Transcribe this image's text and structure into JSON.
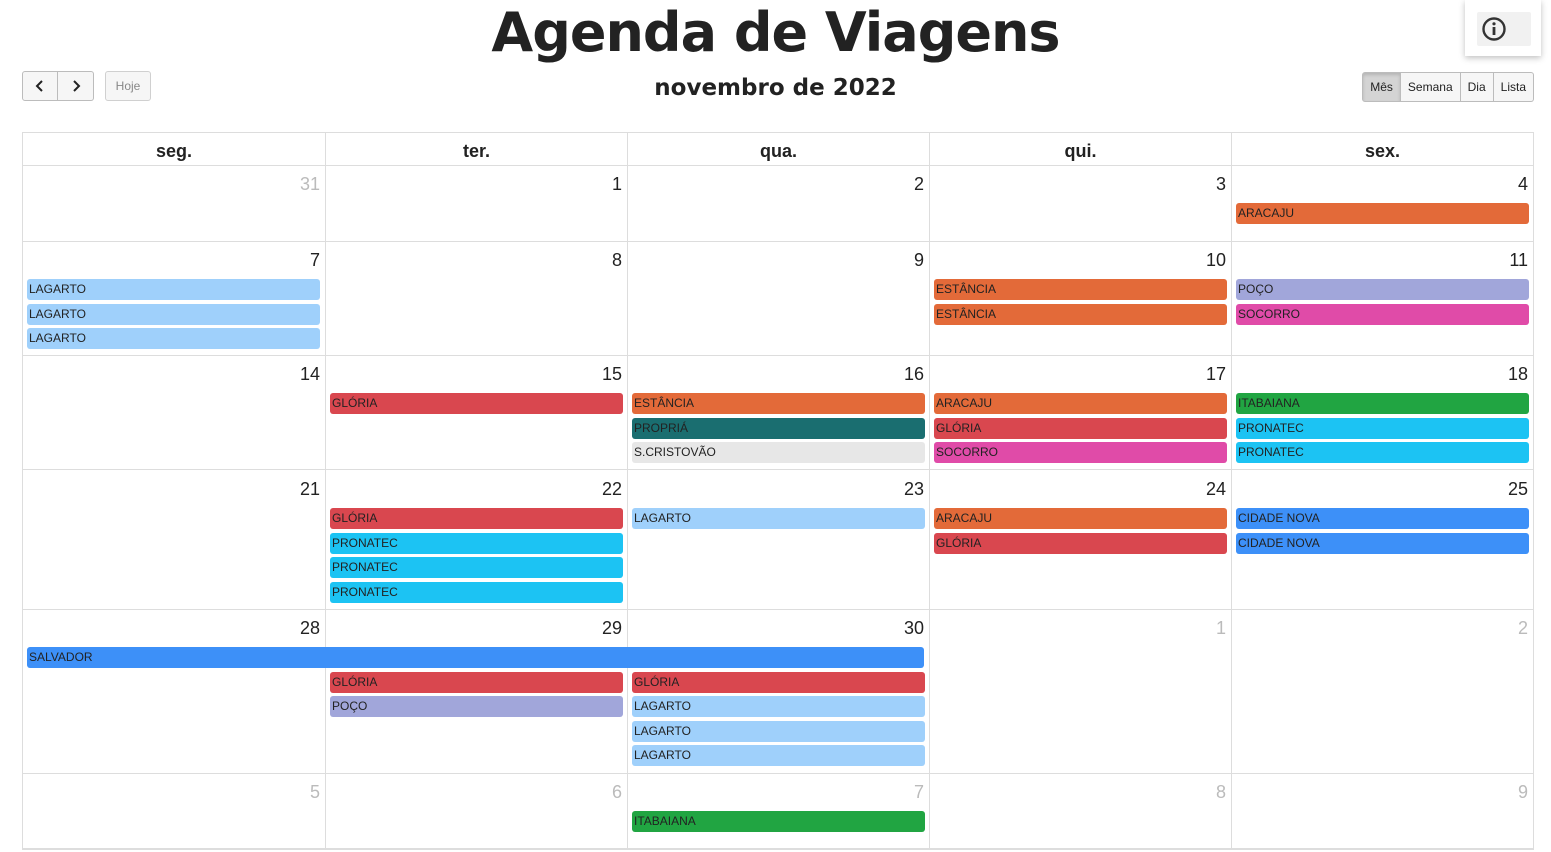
{
  "header": {
    "title": "Agenda de Viagens",
    "month": "novembro de 2022",
    "today_label": "Hoje"
  },
  "views": [
    "Mês",
    "Semana",
    "Dia",
    "Lista"
  ],
  "active_view": "Mês",
  "weekdays": [
    "seg.",
    "ter.",
    "qua.",
    "qui.",
    "sex."
  ],
  "colors": {
    "orange": "#e36a39",
    "lightblue": "#9fd0fb",
    "lavender": "#a1a6da",
    "magenta": "#e04ba8",
    "red": "#d9474f",
    "teal": "#1a6e70",
    "lightgray": "#e7e7e7",
    "green": "#21a542",
    "cyan": "#1cc3f3",
    "blue": "#3d90f8"
  },
  "weeks": [
    {
      "days": [
        {
          "num": "31",
          "other": true,
          "events": []
        },
        {
          "num": "1",
          "events": []
        },
        {
          "num": "2",
          "events": []
        },
        {
          "num": "3",
          "events": []
        },
        {
          "num": "4",
          "events": [
            {
              "label": "ARACAJU",
              "color": "orange"
            }
          ]
        }
      ]
    },
    {
      "days": [
        {
          "num": "7",
          "events": [
            {
              "label": "LAGARTO",
              "color": "lightblue"
            },
            {
              "label": "LAGARTO",
              "color": "lightblue"
            },
            {
              "label": "LAGARTO",
              "color": "lightblue"
            }
          ]
        },
        {
          "num": "8",
          "events": []
        },
        {
          "num": "9",
          "events": []
        },
        {
          "num": "10",
          "events": [
            {
              "label": "ESTÂNCIA",
              "color": "orange"
            },
            {
              "label": "ESTÂNCIA",
              "color": "orange"
            }
          ]
        },
        {
          "num": "11",
          "events": [
            {
              "label": "POÇO",
              "color": "lavender"
            },
            {
              "label": "SOCORRO",
              "color": "magenta"
            }
          ]
        }
      ]
    },
    {
      "days": [
        {
          "num": "14",
          "events": []
        },
        {
          "num": "15",
          "events": [
            {
              "label": "GLÓRIA",
              "color": "red"
            }
          ]
        },
        {
          "num": "16",
          "events": [
            {
              "label": "ESTÂNCIA",
              "color": "orange"
            },
            {
              "label": "PROPRIÁ",
              "color": "teal"
            },
            {
              "label": "S.CRISTOVÃO",
              "color": "lightgray"
            }
          ]
        },
        {
          "num": "17",
          "events": [
            {
              "label": "ARACAJU",
              "color": "orange"
            },
            {
              "label": "GLÓRIA",
              "color": "red"
            },
            {
              "label": "SOCORRO",
              "color": "magenta"
            }
          ]
        },
        {
          "num": "18",
          "events": [
            {
              "label": "ITABAIANA",
              "color": "green"
            },
            {
              "label": "PRONATEC",
              "color": "cyan"
            },
            {
              "label": "PRONATEC",
              "color": "cyan"
            }
          ]
        }
      ]
    },
    {
      "days": [
        {
          "num": "21",
          "events": []
        },
        {
          "num": "22",
          "events": [
            {
              "label": "GLÓRIA",
              "color": "red"
            },
            {
              "label": "PRONATEC",
              "color": "cyan"
            },
            {
              "label": "PRONATEC",
              "color": "cyan"
            },
            {
              "label": "PRONATEC",
              "color": "cyan"
            }
          ]
        },
        {
          "num": "23",
          "events": [
            {
              "label": "LAGARTO",
              "color": "lightblue"
            }
          ]
        },
        {
          "num": "24",
          "events": [
            {
              "label": "ARACAJU",
              "color": "orange"
            },
            {
              "label": "GLÓRIA",
              "color": "red"
            }
          ]
        },
        {
          "num": "25",
          "events": [
            {
              "label": "CIDADE NOVA",
              "color": "blue"
            },
            {
              "label": "CIDADE NOVA",
              "color": "blue"
            }
          ]
        }
      ]
    },
    {
      "spans": [
        {
          "label": "SALVADOR",
          "color": "blue",
          "start_day": 0,
          "day_count": 3
        }
      ],
      "days": [
        {
          "num": "28",
          "events": []
        },
        {
          "num": "29",
          "events": [
            {
              "label": "GLÓRIA",
              "color": "red"
            },
            {
              "label": "POÇO",
              "color": "lavender"
            }
          ]
        },
        {
          "num": "30",
          "events": [
            {
              "label": "GLÓRIA",
              "color": "red"
            },
            {
              "label": "LAGARTO",
              "color": "lightblue"
            },
            {
              "label": "LAGARTO",
              "color": "lightblue"
            },
            {
              "label": "LAGARTO",
              "color": "lightblue"
            }
          ]
        },
        {
          "num": "1",
          "other": true,
          "events": []
        },
        {
          "num": "2",
          "other": true,
          "events": []
        }
      ]
    },
    {
      "days": [
        {
          "num": "5",
          "other": true,
          "events": []
        },
        {
          "num": "6",
          "other": true,
          "events": []
        },
        {
          "num": "7",
          "other": true,
          "events": [
            {
              "label": "ITABAIANA",
              "color": "green"
            }
          ]
        },
        {
          "num": "8",
          "other": true,
          "events": []
        },
        {
          "num": "9",
          "other": true,
          "events": []
        }
      ]
    }
  ]
}
